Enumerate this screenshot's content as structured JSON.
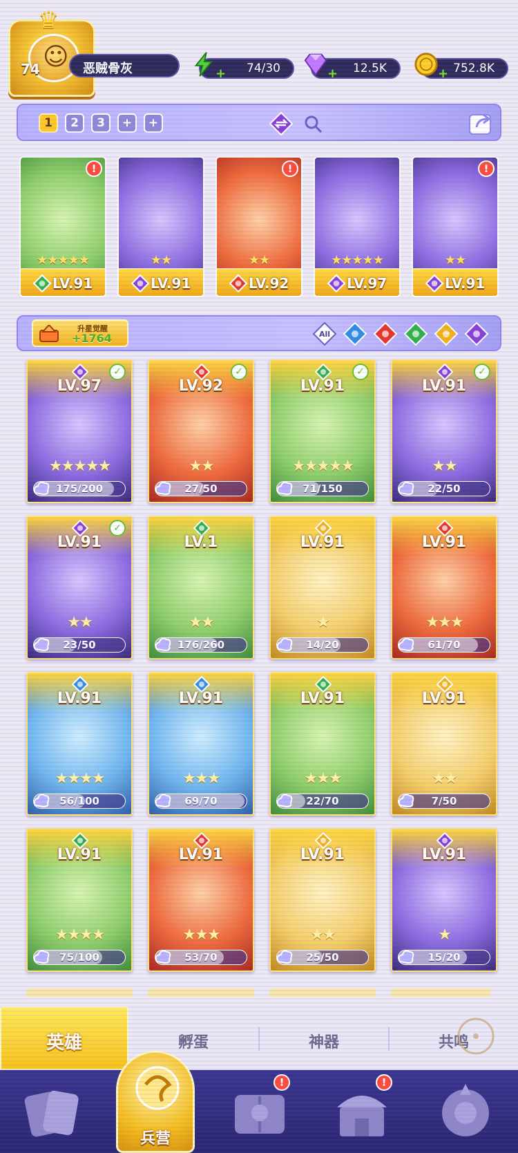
{
  "player": {
    "level": "74",
    "name": "恶贼骨灰"
  },
  "resources": [
    {
      "id": "energy",
      "value": "74/30",
      "icon": "lightning-icon"
    },
    {
      "id": "gems",
      "value": "12.5K",
      "icon": "diamond-icon"
    },
    {
      "id": "gold",
      "value": "752.8K",
      "icon": "coin-icon"
    }
  ],
  "team_tabs": [
    "1",
    "2",
    "3",
    "+",
    "+"
  ],
  "team": [
    {
      "level": "LV.91",
      "element": "nature",
      "stars": "★★★★★",
      "alert": "!"
    },
    {
      "level": "LV.91",
      "element": "dark",
      "stars": "★★",
      "alert": ""
    },
    {
      "level": "LV.92",
      "element": "fire",
      "stars": "★★",
      "alert": "!"
    },
    {
      "level": "LV.97",
      "element": "dark",
      "stars": "★★★★★",
      "alert": ""
    },
    {
      "level": "LV.91",
      "element": "dark",
      "stars": "★★",
      "alert": "!"
    }
  ],
  "awaken": {
    "label": "升星觉醒",
    "count": "+1764"
  },
  "filters": [
    {
      "id": "all",
      "label": "All"
    },
    {
      "id": "water",
      "label": ""
    },
    {
      "id": "fire",
      "label": ""
    },
    {
      "id": "nature",
      "label": ""
    },
    {
      "id": "light",
      "label": ""
    },
    {
      "id": "dark",
      "label": ""
    }
  ],
  "heroes": [
    {
      "level": "LV.97",
      "element": "dark",
      "stars": "★★★★★",
      "progress": "175/200",
      "fill": 0.875,
      "checked": true
    },
    {
      "level": "LV.92",
      "element": "fire",
      "stars": "★★",
      "progress": "27/50",
      "fill": 0.54,
      "checked": true
    },
    {
      "level": "LV.91",
      "element": "nature",
      "stars": "★★★★★",
      "progress": "71/150",
      "fill": 0.47,
      "checked": true
    },
    {
      "level": "LV.91",
      "element": "dark",
      "stars": "★★",
      "progress": "22/50",
      "fill": 0.44,
      "checked": true
    },
    {
      "level": "LV.91",
      "element": "dark",
      "stars": "★★",
      "progress": "23/50",
      "fill": 0.46,
      "checked": true
    },
    {
      "level": "LV.1",
      "element": "nature",
      "stars": "★★",
      "progress": "176/260",
      "fill": 0.68,
      "checked": false
    },
    {
      "level": "LV.91",
      "element": "light",
      "stars": "★",
      "progress": "14/20",
      "fill": 0.7,
      "checked": false
    },
    {
      "level": "LV.91",
      "element": "fire",
      "stars": "★★★",
      "progress": "61/70",
      "fill": 0.87,
      "checked": false
    },
    {
      "level": "LV.91",
      "element": "water",
      "stars": "★★★★",
      "progress": "56/100",
      "fill": 0.56,
      "checked": false
    },
    {
      "level": "LV.91",
      "element": "water",
      "stars": "★★★",
      "progress": "69/70",
      "fill": 0.98,
      "checked": false
    },
    {
      "level": "LV.91",
      "element": "nature",
      "stars": "★★★",
      "progress": "22/70",
      "fill": 0.31,
      "checked": false
    },
    {
      "level": "LV.91",
      "element": "light",
      "stars": "★★",
      "progress": "7/50",
      "fill": 0.14,
      "checked": false
    },
    {
      "level": "LV.91",
      "element": "nature",
      "stars": "★★★★",
      "progress": "75/100",
      "fill": 0.75,
      "checked": false
    },
    {
      "level": "LV.91",
      "element": "fire",
      "stars": "★★★",
      "progress": "53/70",
      "fill": 0.75,
      "checked": false
    },
    {
      "level": "LV.91",
      "element": "light",
      "stars": "★★",
      "progress": "25/50",
      "fill": 0.5,
      "checked": false
    },
    {
      "level": "LV.91",
      "element": "dark",
      "stars": "★",
      "progress": "15/20",
      "fill": 0.75,
      "checked": false
    }
  ],
  "subtabs": [
    "英雄",
    "孵蛋",
    "神器",
    "共鸣"
  ],
  "nav": [
    {
      "id": "cards",
      "label": "",
      "badge": ""
    },
    {
      "id": "barracks",
      "label": "兵营",
      "badge": ""
    },
    {
      "id": "book",
      "label": "",
      "badge": "!"
    },
    {
      "id": "shop",
      "label": "",
      "badge": "!"
    },
    {
      "id": "guild",
      "label": "",
      "badge": ""
    }
  ],
  "colors": {
    "fire": "#e8352a",
    "water": "#2f8de6",
    "nature": "#2fb24a",
    "light": "#f1b21a",
    "dark": "#8a3fd6",
    "gold": "#f5be1e",
    "navy": "#2e2a5a"
  },
  "art_palettes": {
    "nature": [
      "#d8f5b0",
      "#8fcf6a",
      "#3f8e3a"
    ],
    "dark": [
      "#d8c7ff",
      "#8c6ae0",
      "#3a2a7a"
    ],
    "fire": [
      "#ffd1a6",
      "#f06a3a",
      "#a8281e"
    ],
    "water": [
      "#cfeeff",
      "#6fb6ee",
      "#2e5fa8"
    ],
    "light": [
      "#fff3c0",
      "#f6cf6a",
      "#c28a1e"
    ]
  }
}
